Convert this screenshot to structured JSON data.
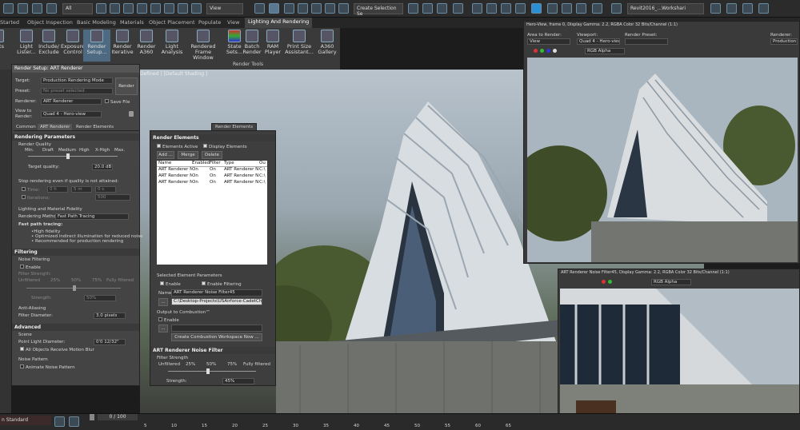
{
  "toolbar": {
    "all_filter": "All",
    "view_select": "View",
    "selection_set": "Create Selection Se",
    "workspace": "Revit2016_...Workshari"
  },
  "ribbon_tabs": [
    "Started",
    "Object Inspection",
    "Basic Modeling",
    "Materials",
    "Object Placement",
    "Populate",
    "View",
    "Lighting And Rendering"
  ],
  "ribbon": {
    "partial_label": "ights",
    "buttons": [
      "Light Lister...",
      "Include/ Exclude",
      "Exposure Control",
      "Render Setup...",
      "Render Iterative",
      "Render A360",
      "Light Analysis",
      "Rendered Frame Window",
      "State Sets...",
      "Batch Render",
      "RAM Player",
      "Print Size Assistant...",
      "A360 Gallery"
    ],
    "group_label": "Render Tools"
  },
  "viewport_label": "Defined ] [Default Shading ]",
  "render_setup": {
    "title": "Render Setup: ART Renderer",
    "target_label": "Target:",
    "target_value": "Production Rendering Mode",
    "preset_label": "Preset:",
    "preset_value": "No preset selected",
    "renderer_label": "Renderer:",
    "renderer_value": "ART Renderer",
    "save_file": "Save File",
    "view_label": "View to Render:",
    "view_value": "Quad 4 - Hero-view",
    "render_btn": "Render",
    "tabs": [
      "Common",
      "ART Renderer",
      "Render Elements"
    ],
    "rp_header": "Rendering Parameters",
    "render_quality": "Render Quality",
    "quality_ticks": [
      "Min.",
      "Draft",
      "Medium",
      "High",
      "X-High",
      "Max."
    ],
    "target_quality_label": "Target quality:",
    "target_quality_value": "20.0 dB",
    "stop_label": "Stop rendering even if quality is not attained:",
    "time_label": "Time:",
    "time_values": [
      "0 h",
      "5 m",
      "0 s"
    ],
    "iterations_label": "Iterations:",
    "iterations_value": "500",
    "lighting_label": "Lighting and Material Fidelity",
    "method_label": "Rendering Method:",
    "method_value": "Fast Path Tracing",
    "fast_path": "Fast path tracing:",
    "bullets": [
      "•High fidelity",
      "• Optimized indirect illumination for reduced noise",
      "• Recommended for production rendering"
    ],
    "filtering_header": "Filtering",
    "noise_filtering": "Noise Filtering",
    "enable": "Enable",
    "filter_strength": "Filter Strength:",
    "strength_ticks": [
      "Unfiltered",
      "25%",
      "50%",
      "75%",
      "Fully filtered"
    ],
    "strength_label": "Strength:",
    "strength_value": "50%",
    "anti_aliasing": "Anti-Aliasing",
    "filter_diam_label": "Filter Diameter:",
    "filter_diam_value": "3.0 pixels",
    "advanced_header": "Advanced",
    "scene": "Scene",
    "point_light_label": "Point Light Diameter:",
    "point_light_value": "0'0 12/32\"",
    "motion_blur": "All Objects Receive Motion Blur",
    "noise_pattern": "Noise Pattern",
    "animate_noise": "Animate Noise Pattern"
  },
  "render_elements": {
    "tab": "Render Elements",
    "header": "Render Elements",
    "elements_active": "Elements Active",
    "display_elements": "Display Elements",
    "add": "Add ...",
    "merge": "Merge ...",
    "delete": "Delete",
    "columns": [
      "Name",
      "Enabled",
      "Filter",
      "Type",
      "Ou"
    ],
    "rows": [
      [
        "ART Renderer N...",
        "On",
        "On",
        "ART Renderer N...",
        "C:\\"
      ],
      [
        "ART Renderer N...",
        "On",
        "On",
        "ART Renderer N...",
        "C:\\"
      ],
      [
        "ART Renderer N...",
        "On",
        "On",
        "ART Renderer N...",
        "C:\\"
      ]
    ],
    "selected_params": "Selected Element Parameters",
    "enable": "Enable",
    "enable_filtering": "Enable Filtering",
    "name_label": "Name:",
    "name_value": "ART Renderer Noise Filter45",
    "path_btn": "...",
    "path_value": "C:\\Desktop-Projects\\USAirforce-CadetChapel\\USA",
    "output_combustion": "Output to Combustion™",
    "combustion_enable": "Enable",
    "create_combustion": "Create Combustion Workspace Now ...",
    "noise_header": "ART Renderer Noise Filter",
    "filter_strength": "Filter Strength",
    "ticks": [
      "Unfiltered",
      "25%",
      "50%",
      "75%",
      "Fully filtered"
    ],
    "strength_label": "Strength:",
    "strength_value": "45%"
  },
  "frame_window": {
    "title": "Hero-View, frame 0, Display Gamma: 2.2, RGBA Color 32 Bits/Channel (1:1)",
    "area_label": "Area to Render:",
    "area_value": "View",
    "viewport_label": "Viewport:",
    "viewport_value": "Quad 4 - Hero-view",
    "preset_label": "Render Preset:",
    "renderer_label": "Renderer:",
    "renderer_value": "Production",
    "channel": "RGB Alpha"
  },
  "noise_window": {
    "title": "ART Renderer Noise Filter45, Display Gamma: 2.2, RGBA Color 32 Bits/Channel (1:1)",
    "channel": "RGB Alpha"
  },
  "status": {
    "workspace": "n Standard",
    "frame": "0 / 100",
    "ticks": [
      "5",
      "10",
      "15",
      "20",
      "25",
      "30",
      "35",
      "40",
      "45",
      "50",
      "55",
      "60",
      "65"
    ]
  },
  "colors": {
    "accent": "#2b8fd6",
    "panel": "#444444",
    "header": "#3a3a3a"
  }
}
